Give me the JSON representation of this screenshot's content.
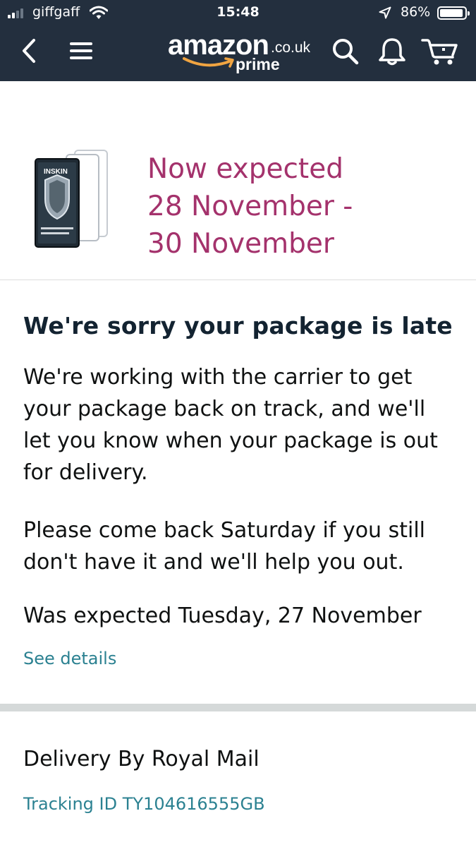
{
  "status_bar": {
    "carrier": "giffgaff",
    "time": "15:48",
    "battery_percent": "86%",
    "battery_level": 0.86,
    "signal_bars": 2
  },
  "nav": {
    "icons": [
      "back-icon",
      "menu-icon",
      "search-icon",
      "bell-icon",
      "cart-icon"
    ],
    "logo": {
      "word": "amazon",
      "tld": ".co.uk",
      "sub": "prime"
    }
  },
  "delivery": {
    "expected_line1": "Now expected",
    "expected_line2": "28 November -",
    "expected_line3": "30 November"
  },
  "notice": {
    "title": "We're sorry your package is late",
    "paragraph1": "We're working with the carrier to get your package back on track, and we'll let you know when your package is out for delivery.",
    "paragraph2": "Please come back Saturday if you still don't have it and we'll help you out.",
    "was_expected": "Was expected Tuesday, 27 November",
    "see_details": "See details"
  },
  "shipment": {
    "carrier": "Delivery By Royal Mail",
    "tracking": "Tracking ID TY104616555GB"
  },
  "colors": {
    "header_bg": "#232f3e",
    "expected_text": "#a4326c",
    "link": "#2b8191",
    "logo_smile": "#f0a441",
    "divider": "#d5d9d9"
  },
  "product": {
    "brand_mark": "INSKIN"
  }
}
